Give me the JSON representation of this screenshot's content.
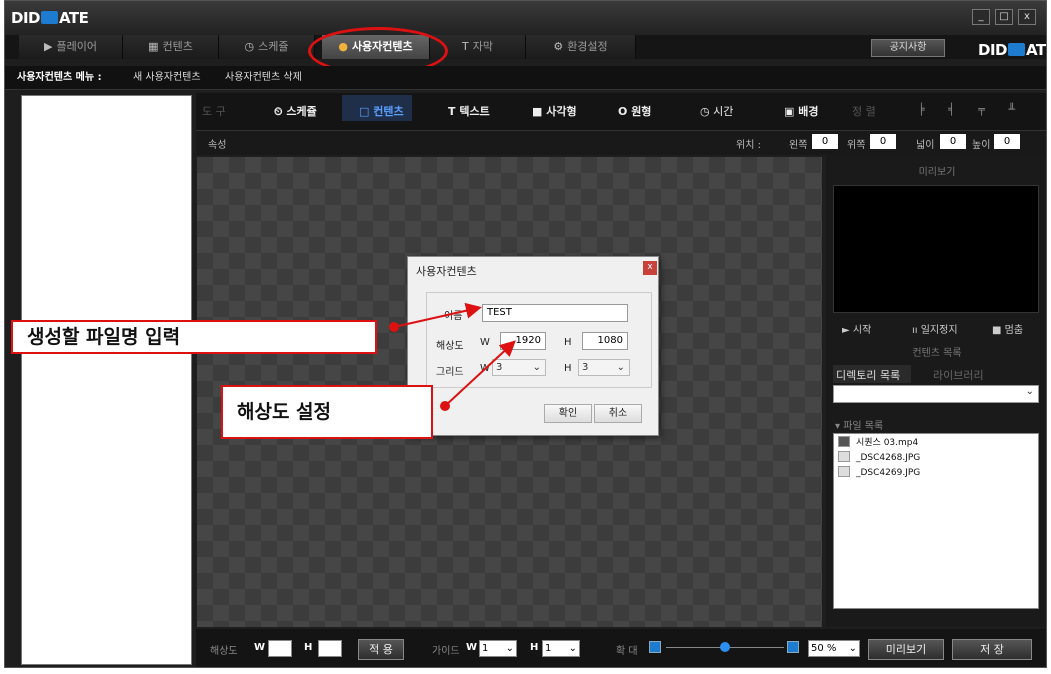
{
  "app": {
    "logo_left": "DID",
    "logo_right": "ATE"
  },
  "window_controls": {
    "minimize": "_",
    "maximize": "□",
    "close": "x"
  },
  "tabs": [
    {
      "label": "플레이어",
      "icon": "play-icon"
    },
    {
      "label": "컨텐츠",
      "icon": "content-icon"
    },
    {
      "label": "스케쥴",
      "icon": "clock-icon"
    },
    {
      "label": "사용자컨텐츠",
      "icon": "user-icon",
      "active": true
    },
    {
      "label": "자막",
      "icon": "text-icon"
    },
    {
      "label": "환경설정",
      "icon": "settings-icon"
    }
  ],
  "notice_button": "공지사항",
  "submenu": {
    "title": "사용자컨텐츠 메뉴 :",
    "new": "새 사용자컨텐츠",
    "delete": "사용자컨텐츠 삭제"
  },
  "toolbar": {
    "tool": "도 구",
    "schedule": "스케쥴",
    "content": "컨텐츠",
    "text": "텍스트",
    "rect": "사각형",
    "circle": "원형",
    "time": "시간",
    "background": "배경",
    "align": "정 렬"
  },
  "props": {
    "label": "속성",
    "position": "위치 :",
    "left_label": "왼쪽",
    "left_value": "0",
    "top_label": "위쪽",
    "top_value": "0",
    "width_label": "넓이",
    "width_value": "0",
    "height_label": "높이",
    "height_value": "0"
  },
  "right_panel": {
    "preview_title": "미리보기",
    "start": "► 시작",
    "pause": "ıı 일지정지",
    "stop": "■ 멈춤",
    "content_list_title": "컨텐츠 목록",
    "dir_tab": "디렉토리 목록",
    "lib_tab": "라이브러리",
    "file_list_title": "▾ 파일 목록",
    "files": [
      "시퀀스 03.mp4",
      "_DSC4268.JPG",
      "_DSC4269.JPG"
    ]
  },
  "bottom": {
    "res_label": "해상도",
    "w": "W",
    "h": "H",
    "apply": "적 용",
    "guide_label": "가이드",
    "guide_w": "1",
    "guide_h": "1",
    "zoom_label": "확 대",
    "zoom_value": "50 %",
    "preview": "미리보기",
    "save": "저 장"
  },
  "dialog": {
    "title": "사용자컨텐츠",
    "close": "x",
    "name_label": "이름",
    "name_value": "TEST",
    "res_label": "해상도",
    "w": "W",
    "w_value": "1920",
    "h": "H",
    "h_value": "1080",
    "grid_label": "그리드",
    "grid_w": "3",
    "grid_h": "3",
    "ok": "확인",
    "cancel": "취소"
  },
  "annotations": {
    "filename": "생성할 파일명 입력",
    "resolution": "해상도 설정"
  },
  "colors": {
    "highlight_red": "#dd1111",
    "selected_blue": "#5aa0ff"
  }
}
